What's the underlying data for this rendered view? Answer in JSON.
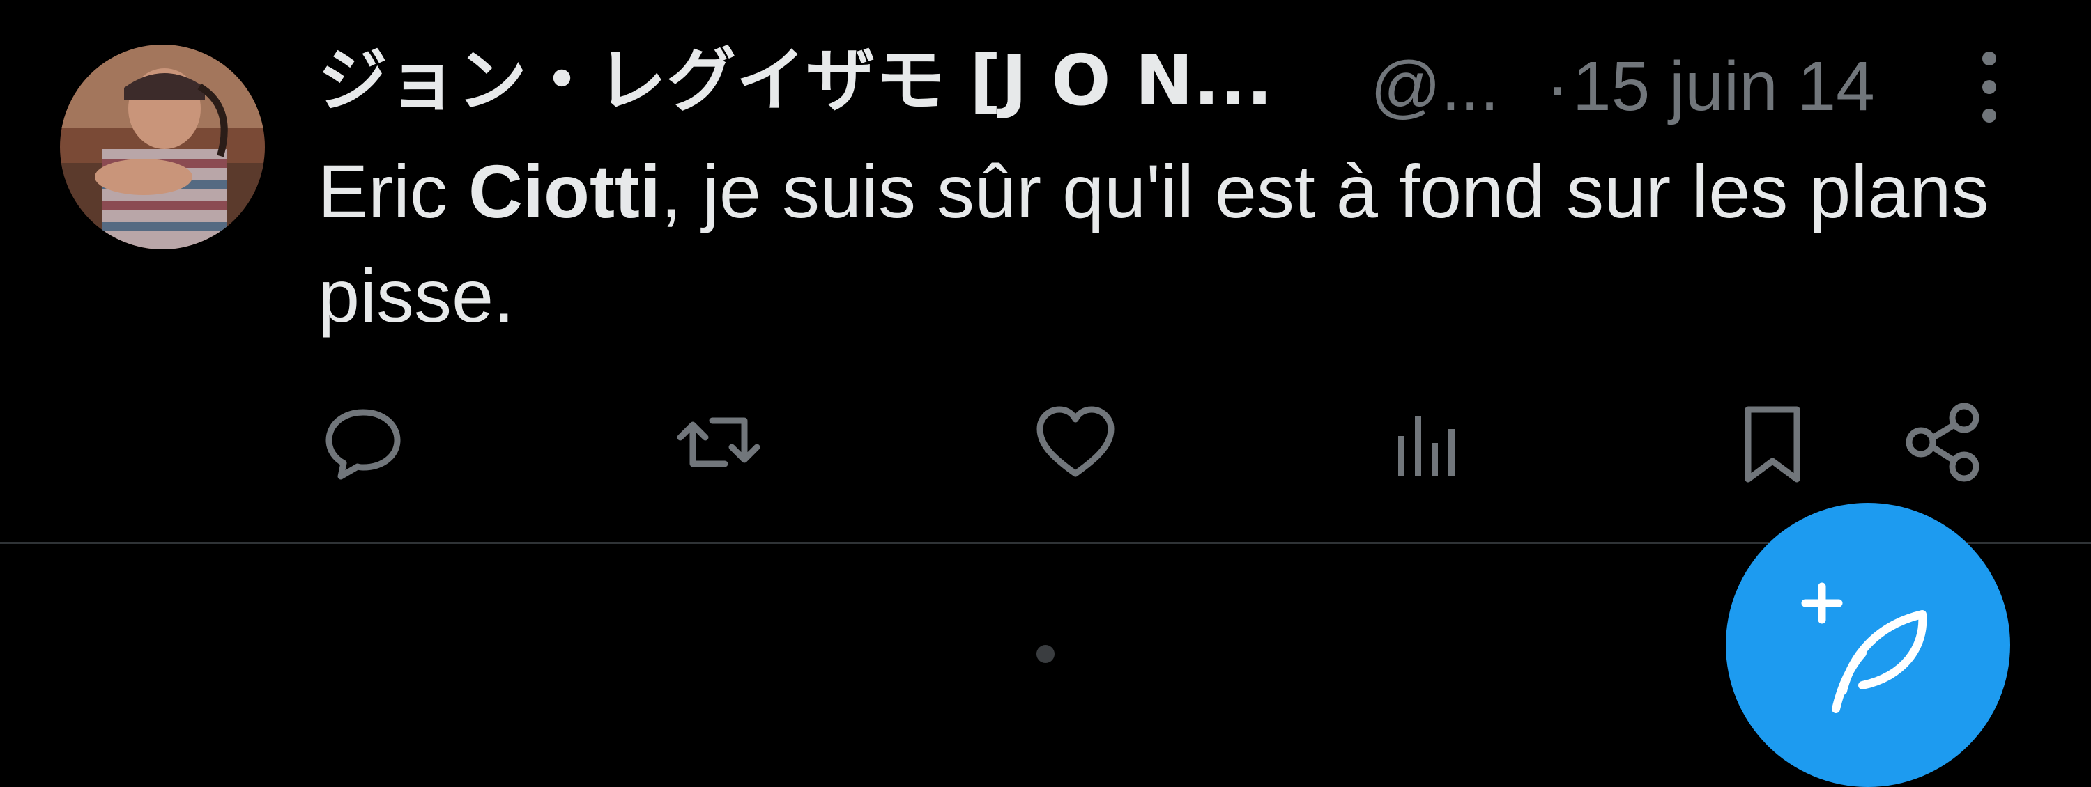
{
  "tweet": {
    "author": {
      "display_name": "ジョン・レグイザモ [J O N...",
      "handle": "@..."
    },
    "separator": "·",
    "timestamp": "15 juin 14",
    "text": {
      "before": "Eric ",
      "bold": "Ciotti",
      "after": ", je suis sûr qu'il est à fond sur les plans pisse."
    }
  },
  "icons": {
    "more": "more-vertical-icon",
    "reply": "reply-icon",
    "retweet": "retweet-icon",
    "like": "heart-icon",
    "views": "views-chart-icon",
    "bookmark": "bookmark-icon",
    "share": "share-icon",
    "compose": "compose-feather-icon"
  },
  "colors": {
    "background": "#000000",
    "text": "#e7e9ea",
    "secondary": "#71767b",
    "accent": "#1d9bf0",
    "divider": "#2f3336"
  }
}
